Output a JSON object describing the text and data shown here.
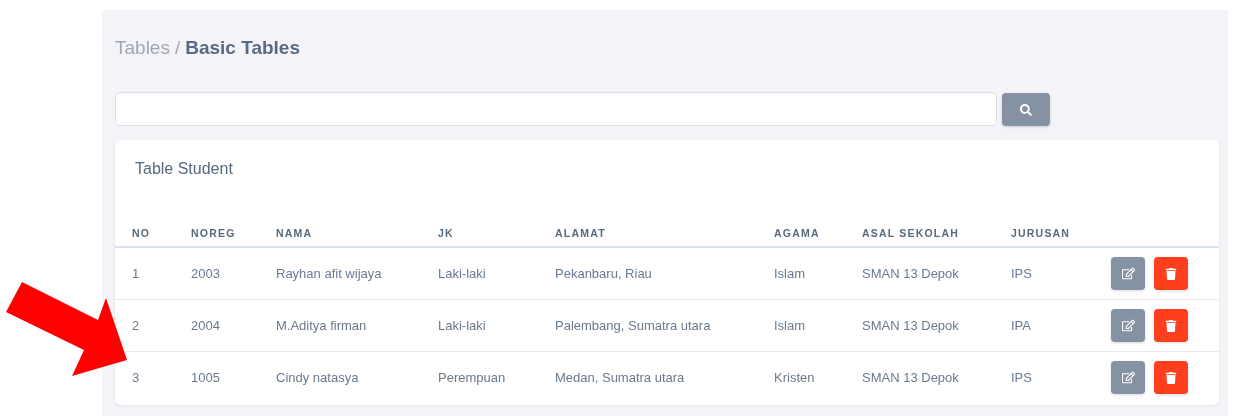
{
  "breadcrumb": {
    "parent": "Tables",
    "separator": "/",
    "current": "Basic Tables"
  },
  "table": {
    "title": "Table Student",
    "columns": [
      "NO",
      "NOREG",
      "NAMA",
      "JK",
      "ALAMAT",
      "AGAMA",
      "ASAL SEKOLAH",
      "JURUSAN"
    ],
    "rows": [
      {
        "cells": [
          "1",
          "2003",
          "Rayhan afit wijaya",
          "Laki-laki",
          "Pekanbaru, Riau",
          "Islam",
          "SMAN 13 Depok",
          "IPS"
        ]
      },
      {
        "cells": [
          "2",
          "2004",
          "M.Aditya firman",
          "Laki-laki",
          "Palembang, Sumatra utara",
          "Islam",
          "SMAN 13 Depok",
          "IPA"
        ]
      },
      {
        "cells": [
          "3",
          "1005",
          "Cindy natasya",
          "Perempuan",
          "Medan, Sumatra utara",
          "Kristen",
          "SMAN 13 Depok",
          "IPS"
        ]
      }
    ]
  }
}
